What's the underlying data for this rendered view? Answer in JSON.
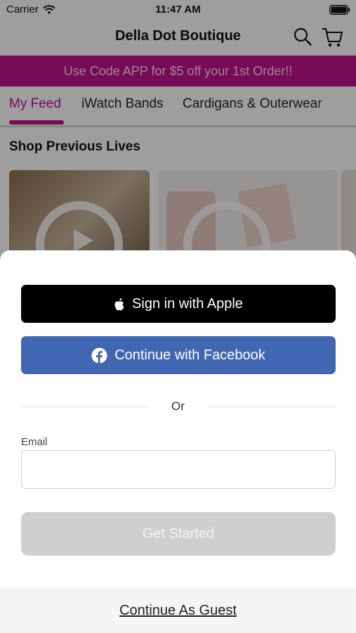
{
  "status_bar": {
    "carrier": "Carrier",
    "time": "11:47 AM"
  },
  "nav": {
    "title": "Della Dot Boutique",
    "icons": [
      "search-icon",
      "cart-icon"
    ]
  },
  "promo": {
    "text": "Use Code APP for $5 off your 1st Order!!",
    "background_color": "#c0138f"
  },
  "tabs": [
    {
      "label": "My Feed",
      "active": true
    },
    {
      "label": "iWatch Bands",
      "active": false
    },
    {
      "label": "Cardigans & Outerwear",
      "active": false
    }
  ],
  "feed": {
    "section_title": "Shop Previous Lives"
  },
  "sheet": {
    "apple_label": "Sign in with Apple",
    "facebook_label": "Continue with Facebook",
    "or_text": "Or",
    "email_label": "Email",
    "email_value": "",
    "email_placeholder": "",
    "get_started_label": "Get Started",
    "guest_label": "Continue As Guest",
    "colors": {
      "apple": "#000000",
      "facebook": "#4267b2",
      "disabled_button": "#cfcfcf"
    }
  }
}
